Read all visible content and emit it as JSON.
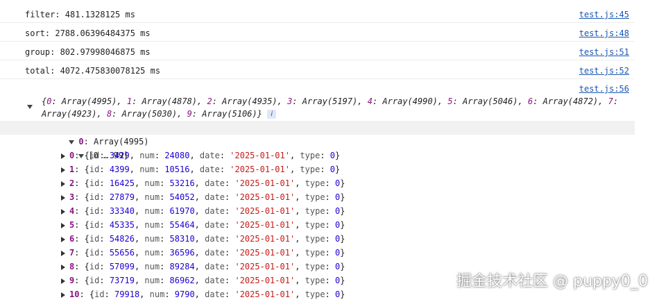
{
  "logs": [
    {
      "text": "filter: 481.1328125 ms",
      "source": "test.js:45"
    },
    {
      "text": "sort: 2788.06396484375 ms",
      "source": "test.js:48"
    },
    {
      "text": "group: 802.97998046875 ms",
      "source": "test.js:51"
    },
    {
      "text": "total: 4072.475830078125 ms",
      "source": "test.js:52"
    }
  ],
  "object_log": {
    "source": "test.js:56",
    "summary_items": [
      {
        "key": "0",
        "value": "Array(4995)"
      },
      {
        "key": "1",
        "value": "Array(4878)"
      },
      {
        "key": "2",
        "value": "Array(4935)"
      },
      {
        "key": "3",
        "value": "Array(5197)"
      },
      {
        "key": "4",
        "value": "Array(4990)"
      },
      {
        "key": "5",
        "value": "Array(5046)"
      },
      {
        "key": "6",
        "value": "Array(4872)"
      },
      {
        "key": "7",
        "value": "Array(4923)"
      },
      {
        "key": "8",
        "value": "Array(5030)"
      },
      {
        "key": "9",
        "value": "Array(5106)"
      }
    ],
    "info_icon": "info-icon",
    "expanded_key": "0",
    "expanded_value": "Array(4995)",
    "range_label": "[0 … 99]",
    "items": [
      {
        "index": "0",
        "id": "3429",
        "num": "24080",
        "date": "'2025-01-01'",
        "type": "0"
      },
      {
        "index": "1",
        "id": "4399",
        "num": "10516",
        "date": "'2025-01-01'",
        "type": "0"
      },
      {
        "index": "2",
        "id": "16425",
        "num": "53216",
        "date": "'2025-01-01'",
        "type": "0"
      },
      {
        "index": "3",
        "id": "27879",
        "num": "54052",
        "date": "'2025-01-01'",
        "type": "0"
      },
      {
        "index": "4",
        "id": "33340",
        "num": "61970",
        "date": "'2025-01-01'",
        "type": "0"
      },
      {
        "index": "5",
        "id": "45335",
        "num": "55464",
        "date": "'2025-01-01'",
        "type": "0"
      },
      {
        "index": "6",
        "id": "54826",
        "num": "58310",
        "date": "'2025-01-01'",
        "type": "0"
      },
      {
        "index": "7",
        "id": "55656",
        "num": "36596",
        "date": "'2025-01-01'",
        "type": "0"
      },
      {
        "index": "8",
        "id": "57099",
        "num": "89284",
        "date": "'2025-01-01'",
        "type": "0"
      },
      {
        "index": "9",
        "id": "73719",
        "num": "86962",
        "date": "'2025-01-01'",
        "type": "0"
      },
      {
        "index": "10",
        "id": "79918",
        "num": "9790",
        "date": "'2025-01-01'",
        "type": "0"
      }
    ]
  },
  "watermark": "掘金技术社区 @ puppy0_0"
}
